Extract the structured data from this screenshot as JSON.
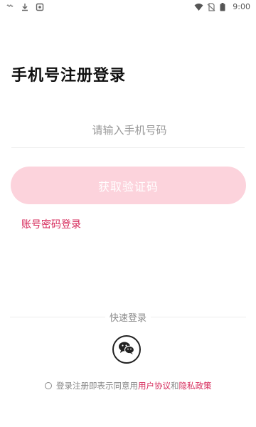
{
  "status_bar": {
    "time": "9:00",
    "left_icons": [
      "notification-icon",
      "download-icon",
      "app-icon"
    ],
    "right_icons": [
      "wifi-icon",
      "no-sim-icon",
      "battery-icon"
    ]
  },
  "page": {
    "title": "手机号注册登录"
  },
  "phone_input": {
    "placeholder": "请输入手机号码",
    "value": ""
  },
  "get_code_button": {
    "label": "获取验证码"
  },
  "password_login_link": {
    "label": "账号密码登录"
  },
  "quick_login": {
    "label": "快速登录",
    "icon": "wechat-icon"
  },
  "agreement": {
    "prefix": "登录注册即表示同意用",
    "user_agreement": "用户协议",
    "and": "和",
    "privacy_policy": "隐私政策"
  },
  "colors": {
    "accent": "#d6295a",
    "button_disabled": "#fcd3dc"
  }
}
